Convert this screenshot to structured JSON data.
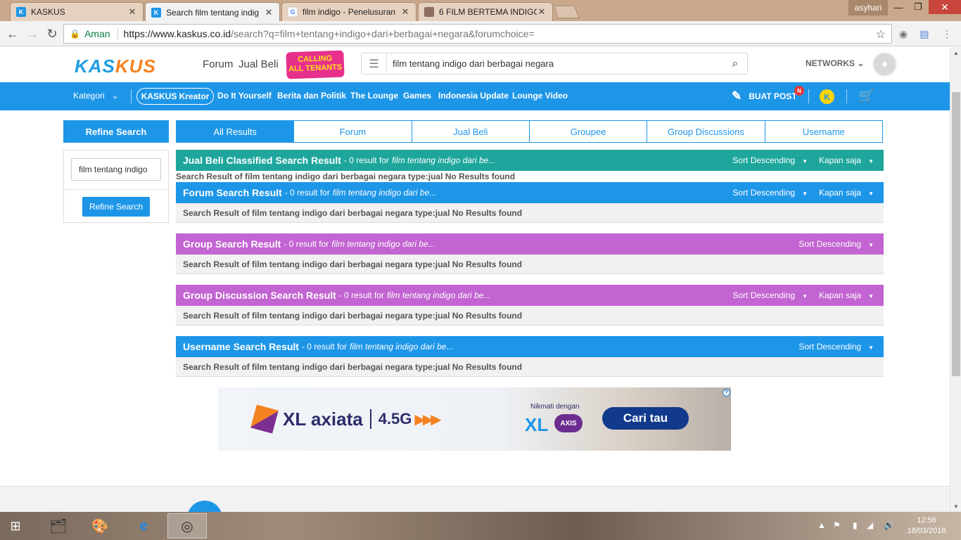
{
  "browser": {
    "tabs": [
      {
        "title": "KASKUS",
        "active": false,
        "favicon_color": "#1e96e8"
      },
      {
        "title": "Search film tentang indig",
        "active": true,
        "favicon_color": "#1e96e8"
      },
      {
        "title": "film indigo - Penelusuran",
        "active": false,
        "favicon_color": "#4285f4"
      },
      {
        "title": "6 FILM BERTEMA INDIGO",
        "active": false,
        "favicon_color": "#8d6e63"
      }
    ],
    "user": "asyhari",
    "secure_label": "Aman",
    "url_host": "https://www.kaskus.co.id",
    "url_rest": "/search?q=film+tentang+indigo+dari+berbagai+negara&forumchoice="
  },
  "header": {
    "logo_a": "KAS",
    "logo_b": "KUS",
    "links": [
      "Forum",
      "Jual Beli"
    ],
    "calling_line1": "CALLING",
    "calling_line2": "ALL TENANTS",
    "search_value": "film tentang indigo dari berbagai negara",
    "networks": "NETWORKS"
  },
  "nav": {
    "kategori": "Kategori",
    "kreator": "KASKUS Kreator",
    "items": [
      "Do It Yourself",
      "Berita dan Politik",
      "The Lounge",
      "Games",
      "Indonesia Update",
      "Lounge Video"
    ],
    "buat_post": "BUAT POST",
    "badge": "N"
  },
  "sidebar": {
    "title": "Refine Search",
    "input_value": "film tentang indigo",
    "button": "Refine Search"
  },
  "result_tabs": [
    "All Results",
    "Forum",
    "Jual Beli",
    "Groupee",
    "Group Discussions",
    "Username"
  ],
  "results": {
    "jualbeli": {
      "title": "Jual Beli Classified Search Result",
      "count": "- 0 result for",
      "query": "film tentang indigo dari be...",
      "sort": "Sort Descending",
      "time": "Kapan saja",
      "body": "Search Result of film tentang indigo dari berbagai negara type:jual No Results found"
    },
    "forum": {
      "title": "Forum Search Result",
      "count": "- 0 result for",
      "query": "film tentang indigo dari be...",
      "sort": "Sort Descending",
      "time": "Kapan saja",
      "body": "Search Result of film tentang indigo dari berbagai negara type:jual No Results found"
    },
    "group": {
      "title": "Group Search Result",
      "count": "- 0 result for",
      "query": "film tentang indigo dari be...",
      "sort": "Sort Descending",
      "body": "Search Result of film tentang indigo dari berbagai negara type:jual No Results found"
    },
    "groupdisc": {
      "title": "Group Discussion Search Result",
      "count": "- 0 result for",
      "query": "film tentang indigo dari be...",
      "sort": "Sort Descending",
      "time": "Kapan saja",
      "body": "Search Result of film tentang indigo dari berbagai negara type:jual No Results found"
    },
    "username": {
      "title": "Username Search Result",
      "count": "- 0 result for",
      "query": "film tentang indigo dari be...",
      "sort": "Sort Descending",
      "body": "Search Result of film tentang indigo dari berbagai negara type:jual No Results found"
    }
  },
  "ad": {
    "brand": "XL axiata",
    "network": "4.5G",
    "nikmati": "Nikmati dengan",
    "xl": "XL",
    "axis": "AXIS",
    "cta": "Cari tau"
  },
  "taskbar": {
    "time": "12:56",
    "date": "18/03/2018"
  }
}
